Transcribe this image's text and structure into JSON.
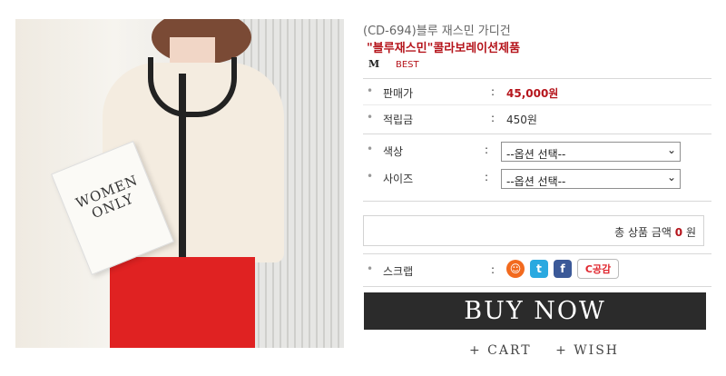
{
  "product": {
    "code_title": "(CD-694)블루 재스민 가디건",
    "collab_title": "\"블루재스민\"콜라보레이션제품",
    "badge_text": "BEST",
    "photo_text": "WOMEN ONLY"
  },
  "details": {
    "price_label": "판매가",
    "price_value": "45,000원",
    "points_label": "적립금",
    "points_value": "450원",
    "colon": ":"
  },
  "options": {
    "color_label": "색상",
    "size_label": "사이즈",
    "color_selected": "--옵션 선택--",
    "size_selected": "--옵션 선택--"
  },
  "total": {
    "prefix": "총 상품 금액",
    "amount": "0",
    "suffix": "원"
  },
  "scrap": {
    "label": "스크랩",
    "me_glyph": "☺",
    "twitter_glyph": "t",
    "facebook_glyph": "f",
    "cgong_glyph": "C공감"
  },
  "actions": {
    "buy_now": "BUY NOW",
    "cart": "+ CART",
    "wish": "+ WISH"
  },
  "colors": {
    "accent": "#b5141b",
    "buy_button": "#2b2b2b"
  }
}
